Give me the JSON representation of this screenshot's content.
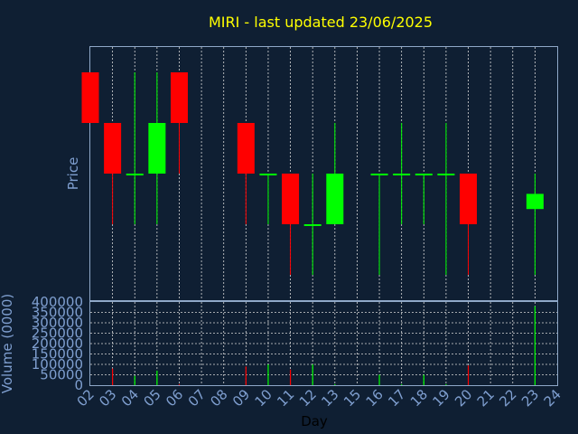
{
  "chart_data": {
    "type": "candlestick",
    "title": "MIRI - last updated 23/06/2025",
    "price_panel": {
      "ylabel": "Price",
      "yticks_shown": false,
      "grid": true
    },
    "volume_panel": {
      "ylabel": "Volume (0000)",
      "ylim": [
        0,
        400000
      ],
      "yticks": [
        "0",
        "50000",
        "100000",
        "150000",
        "200000",
        "250000",
        "300000",
        "350000",
        "400000"
      ],
      "grid": true
    },
    "xlabel": "Day",
    "x_ticks": [
      "02",
      "03",
      "04",
      "05",
      "06",
      "07",
      "08",
      "09",
      "10",
      "11",
      "12",
      "13",
      "15",
      "16",
      "17",
      "18",
      "19",
      "20",
      "21",
      "22",
      "23",
      "24"
    ],
    "up_color": "#00ff00",
    "down_color": "#ff0000",
    "grid_color": "#ffffff",
    "candles": [
      {
        "day": "02",
        "open": 5,
        "high": 5,
        "low": 4,
        "close": 4,
        "volume": 0
      },
      {
        "day": "03",
        "open": 4,
        "high": 4,
        "low": 2,
        "close": 3,
        "volume": 80000
      },
      {
        "day": "04",
        "open": 3,
        "high": 5,
        "low": 2,
        "close": 3,
        "volume": 45000
      },
      {
        "day": "05",
        "open": 3,
        "high": 5,
        "low": 2,
        "close": 4,
        "volume": 70000
      },
      {
        "day": "06",
        "open": 5,
        "high": 5,
        "low": 3,
        "close": 4,
        "volume": 5000
      },
      {
        "day": "09",
        "open": 4,
        "high": 4,
        "low": 2,
        "close": 3,
        "volume": 90000
      },
      {
        "day": "10",
        "open": 3,
        "high": 3,
        "low": 2,
        "close": 3,
        "volume": 100000
      },
      {
        "day": "11",
        "open": 3,
        "high": 3,
        "low": 1,
        "close": 2,
        "volume": 75000
      },
      {
        "day": "12",
        "open": 2,
        "high": 3,
        "low": 1,
        "close": 2,
        "volume": 100000
      },
      {
        "day": "13",
        "open": 2,
        "high": 4,
        "low": 2,
        "close": 3,
        "volume": 5000
      },
      {
        "day": "16",
        "open": 3,
        "high": 3,
        "low": 1,
        "close": 3,
        "volume": 50000
      },
      {
        "day": "17",
        "open": 3,
        "high": 4,
        "low": 2,
        "close": 3,
        "volume": 5000
      },
      {
        "day": "18",
        "open": 3,
        "high": 3,
        "low": 2,
        "close": 3,
        "volume": 50000
      },
      {
        "day": "19",
        "open": 3,
        "high": 4,
        "low": 1,
        "close": 3,
        "volume": 5000
      },
      {
        "day": "20",
        "open": 3,
        "high": 3,
        "low": 1,
        "close": 2,
        "volume": 95000
      },
      {
        "day": "23",
        "open": 2.3,
        "high": 3,
        "low": 1,
        "close": 2.6,
        "volume": 380000
      }
    ]
  }
}
